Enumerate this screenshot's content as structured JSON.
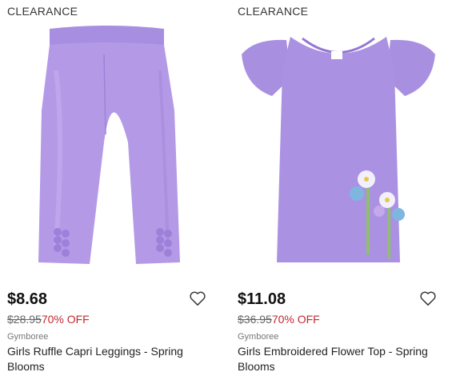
{
  "products": [
    {
      "badge": "CLEARANCE",
      "price": "$8.68",
      "original_price": "$28.95",
      "discount": "70% OFF",
      "brand": "Gymboree",
      "title": "Girls Ruffle Capri Leggings - Spring Blooms",
      "image_color": "#b49ae6"
    },
    {
      "badge": "CLEARANCE",
      "price": "$11.08",
      "original_price": "$36.95",
      "discount": "70% OFF",
      "brand": "Gymboree",
      "title": "Girls Embroidered Flower Top - Spring Blooms",
      "image_color": "#a98fe0"
    }
  ],
  "icons": {
    "wishlist": "heart-outline-icon"
  },
  "colors": {
    "discount": "#c0282f",
    "text": "#222222"
  }
}
